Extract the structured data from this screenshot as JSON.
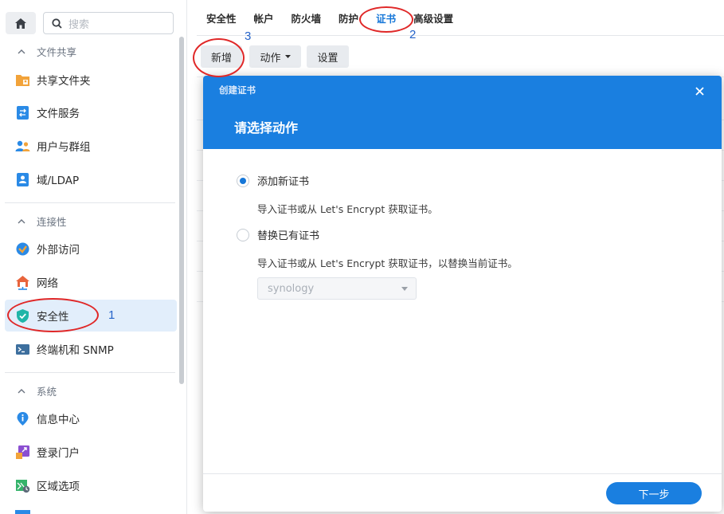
{
  "search": {
    "placeholder": "搜索"
  },
  "sidebar": {
    "sections": [
      {
        "label": "文件共享"
      },
      {
        "label": "连接性"
      },
      {
        "label": "系统"
      }
    ],
    "items": [
      {
        "label": "共享文件夹",
        "icon": "shared-folder-icon"
      },
      {
        "label": "文件服务",
        "icon": "file-services-icon"
      },
      {
        "label": "用户与群组",
        "icon": "users-icon"
      },
      {
        "label": "域/LDAP",
        "icon": "ldap-icon"
      },
      {
        "label": "外部访问",
        "icon": "external-access-icon"
      },
      {
        "label": "网络",
        "icon": "network-icon"
      },
      {
        "label": "安全性",
        "icon": "shield-icon",
        "active": true
      },
      {
        "label": "终端机和 SNMP",
        "icon": "terminal-icon"
      },
      {
        "label": "信息中心",
        "icon": "info-icon"
      },
      {
        "label": "登录门户",
        "icon": "login-portal-icon"
      },
      {
        "label": "区域选项",
        "icon": "regional-icon"
      }
    ]
  },
  "tabs": [
    {
      "label": "安全性"
    },
    {
      "label": "帐户"
    },
    {
      "label": "防火墙"
    },
    {
      "label": "防护"
    },
    {
      "label": "证书",
      "active": true
    },
    {
      "label": "高级设置"
    }
  ],
  "toolbar": {
    "new_label": "新增",
    "action_label": "动作",
    "settings_label": "设置"
  },
  "annotations": {
    "one": "1",
    "two": "2",
    "three": "3"
  },
  "modal": {
    "small_title": "创建证书",
    "title": "请选择动作",
    "options": [
      {
        "label": "添加新证书",
        "description": "导入证书或从 Let's Encrypt 获取证书。",
        "checked": true
      },
      {
        "label": "替换已有证书",
        "description": "导入证书或从 Let's Encrypt 获取证书，以替换当前证书。",
        "checked": false
      }
    ],
    "select_value": "synology",
    "next_label": "下一步"
  },
  "colors": {
    "accent": "#1a7fe0",
    "annotation_red": "#e02828",
    "annotation_blue": "#2563c9",
    "active_bg": "#e2eefb"
  }
}
